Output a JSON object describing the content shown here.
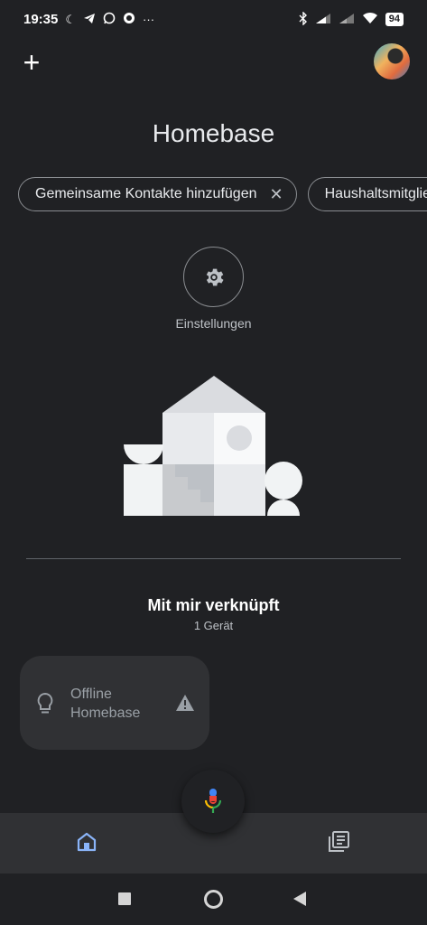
{
  "status_bar": {
    "time": "19:35",
    "left_icons": [
      "moon-icon",
      "telegram-icon",
      "whatsapp-icon",
      "signal-icon"
    ],
    "more": "···",
    "right_icons": [
      "bluetooth-icon",
      "cell-signal-icon",
      "cell-signal-icon",
      "wifi-icon"
    ],
    "battery": "94"
  },
  "header": {
    "add_icon": "+",
    "title": "Homebase"
  },
  "chips": [
    {
      "label": "Gemeinsame Kontakte hinzufügen",
      "close": "✕"
    },
    {
      "label": "Haushaltsmitglied hinzufügen"
    }
  ],
  "settings": {
    "label": "Einstellungen"
  },
  "linked": {
    "title": "Mit mir verknüpft",
    "subtitle": "1 Gerät"
  },
  "device": {
    "name": "Offline Homebase",
    "status": "offline"
  },
  "colors": {
    "background": "#202124",
    "surface": "#303134",
    "accent_blue": "#8ab4f8"
  }
}
